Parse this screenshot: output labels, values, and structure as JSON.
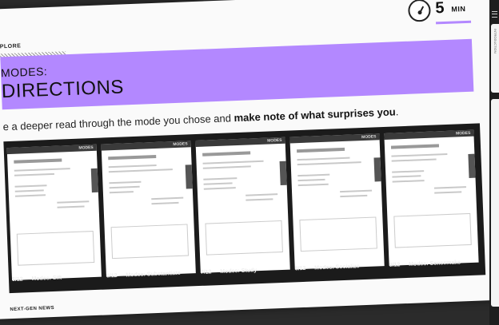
{
  "slide": {
    "section_label": "PLORE",
    "banner_line1": "MODES:",
    "banner_line2": "DIRECTIONS",
    "timer": {
      "value": "5",
      "unit": "MIN"
    },
    "instruction_prefix": "e a deeper read through the mode you chose and ",
    "instruction_bold": "make note of what surprises you",
    "instruction_suffix": ".",
    "footer": "NEXT-GEN NEWS"
  },
  "cards": [
    {
      "tag": "MODES",
      "caption": "5/12 — Modes: Sift"
    },
    {
      "tag": "MODES",
      "caption": "6/12 — Modes: Substantiate"
    },
    {
      "tag": "MODES",
      "caption": "7/12 — Modes: Study"
    },
    {
      "tag": "MODES",
      "caption": "8/12 — Modes: Socialize"
    },
    {
      "tag": "MODES",
      "caption": "9/12 — Modes: Sensemake"
    }
  ],
  "sidebar": {
    "tab_label": "INTRODUCTION"
  },
  "colors": {
    "accent": "#b388ff",
    "strip": "#1b1b1b",
    "background": "#2b2b2b"
  }
}
